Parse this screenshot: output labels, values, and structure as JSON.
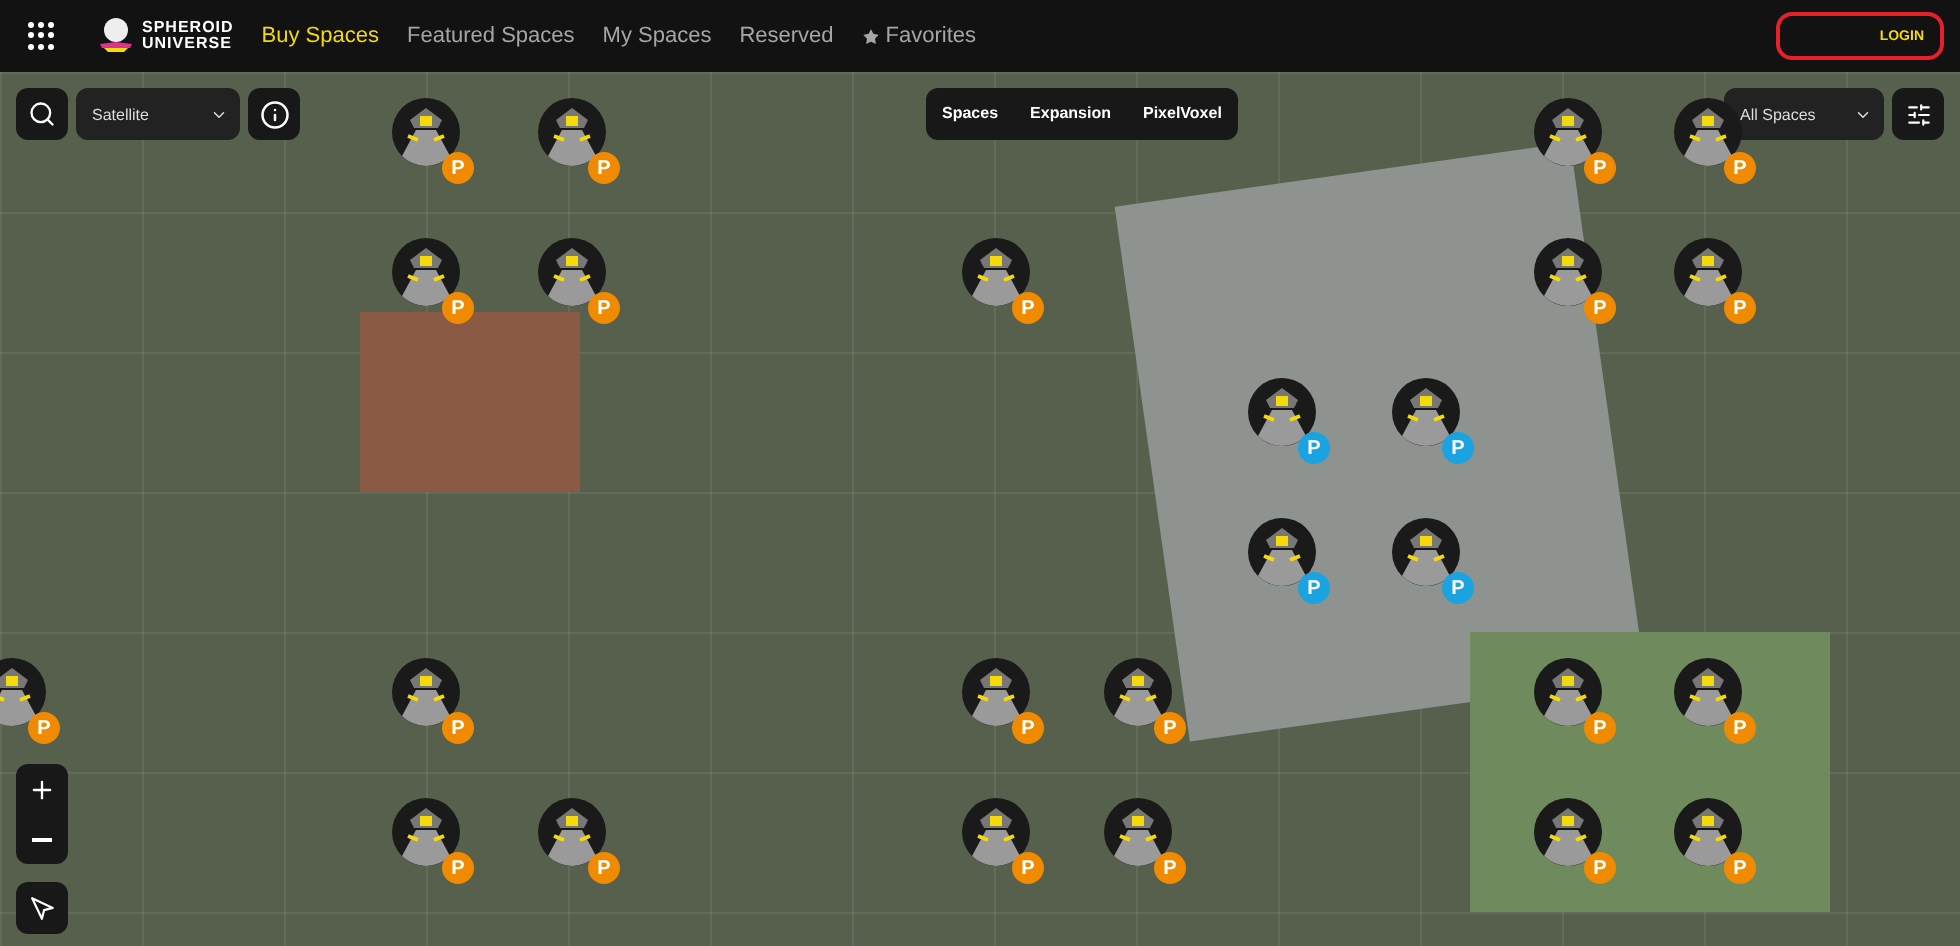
{
  "header": {
    "logo": {
      "line_1": "SPHEROID",
      "line_2": "UNIVERSE"
    },
    "nav": [
      {
        "label": "Buy Spaces",
        "selected": true
      },
      {
        "label": "Featured Spaces",
        "selected": false
      },
      {
        "label": "My Spaces",
        "selected": false
      },
      {
        "label": "Reserved",
        "selected": false
      },
      {
        "label": "Favorites",
        "selected": false,
        "kind": "starred"
      }
    ],
    "login": "LOGIN"
  },
  "map_controls": {
    "layer_select": "Satellite",
    "space_tabs": [
      {
        "label": "Spaces",
        "selected": false
      },
      {
        "label": "Expansion",
        "selected": false
      },
      {
        "label": "PixelVoxel",
        "selected": false
      }
    ],
    "filter_select": "All Spaces"
  },
  "pins": [
    {
      "badge": "P",
      "color": "#f08a00"
    },
    {
      "badge": "P",
      "color": "#f08a00"
    },
    {
      "badge": "P",
      "color": "#f08a00"
    },
    {
      "badge": "P",
      "color": "#f08a00"
    },
    {
      "badge": "P",
      "color": "#f08a00"
    },
    {
      "badge": "P",
      "color": "#f08a00"
    },
    {
      "badge": "P",
      "color": "#f08a00"
    },
    {
      "badge": "P",
      "color": "#f08a00"
    },
    {
      "badge": "P",
      "color": "#f08a00"
    },
    {
      "badge": "P",
      "color": "#1aa3e0"
    },
    {
      "badge": "P",
      "color": "#1aa3e0"
    },
    {
      "badge": "P",
      "color": "#1aa3e0"
    },
    {
      "badge": "P",
      "color": "#1aa3e0"
    },
    {
      "badge": "P",
      "color": "#f08a00"
    },
    {
      "badge": "P",
      "color": "#f08a00"
    },
    {
      "badge": "P",
      "color": "#f08a00"
    },
    {
      "badge": "P",
      "color": "#f08a00"
    },
    {
      "badge": "P",
      "color": "#f08a00"
    },
    {
      "badge": "P",
      "color": "#f08a00"
    },
    {
      "badge": "P",
      "color": "#f08a00"
    },
    {
      "badge": "P",
      "color": "#f08a00"
    },
    {
      "badge": "P",
      "color": "#f08a00"
    },
    {
      "badge": "P",
      "color": "#f08a00"
    },
    {
      "badge": "P",
      "color": "#f08a00"
    },
    {
      "badge": "P",
      "color": "#f08a00"
    }
  ]
}
